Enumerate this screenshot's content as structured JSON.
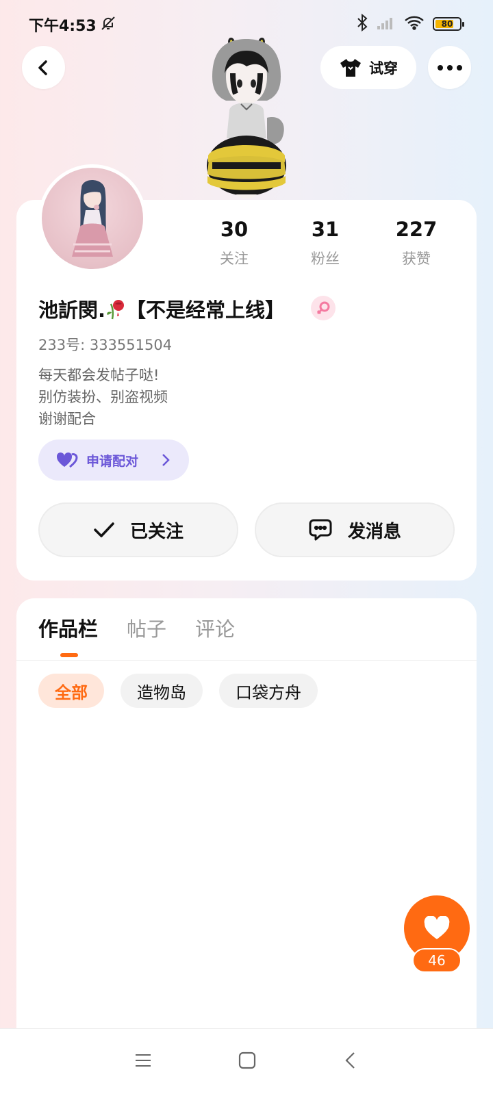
{
  "status_bar": {
    "time": "下午4:53",
    "battery": "80",
    "battery_level": 0.8
  },
  "top_bar": {
    "tryon_label": "试穿"
  },
  "profile": {
    "stats": [
      {
        "value": "30",
        "label": "关注"
      },
      {
        "value": "31",
        "label": "粉丝"
      },
      {
        "value": "227",
        "label": "获赞"
      }
    ],
    "nickname_prefix": "池訢閔.",
    "nickname_suffix": "【不是经常上线】",
    "uid": "233号: 333551504",
    "bio": [
      "每天都会发帖子哒!",
      "别仿装扮、别盗视频",
      "谢谢配合"
    ],
    "pair_label": "申请配对",
    "follow_label": "已关注",
    "message_label": "发消息"
  },
  "tabs": [
    "作品栏",
    "帖子",
    "评论"
  ],
  "filters": [
    "全部",
    "造物岛",
    "口袋方舟"
  ],
  "like": {
    "count": "46"
  },
  "colors": {
    "accent": "#ff6a12",
    "pair": "#6b57d8",
    "gender": "#f47aa0"
  }
}
